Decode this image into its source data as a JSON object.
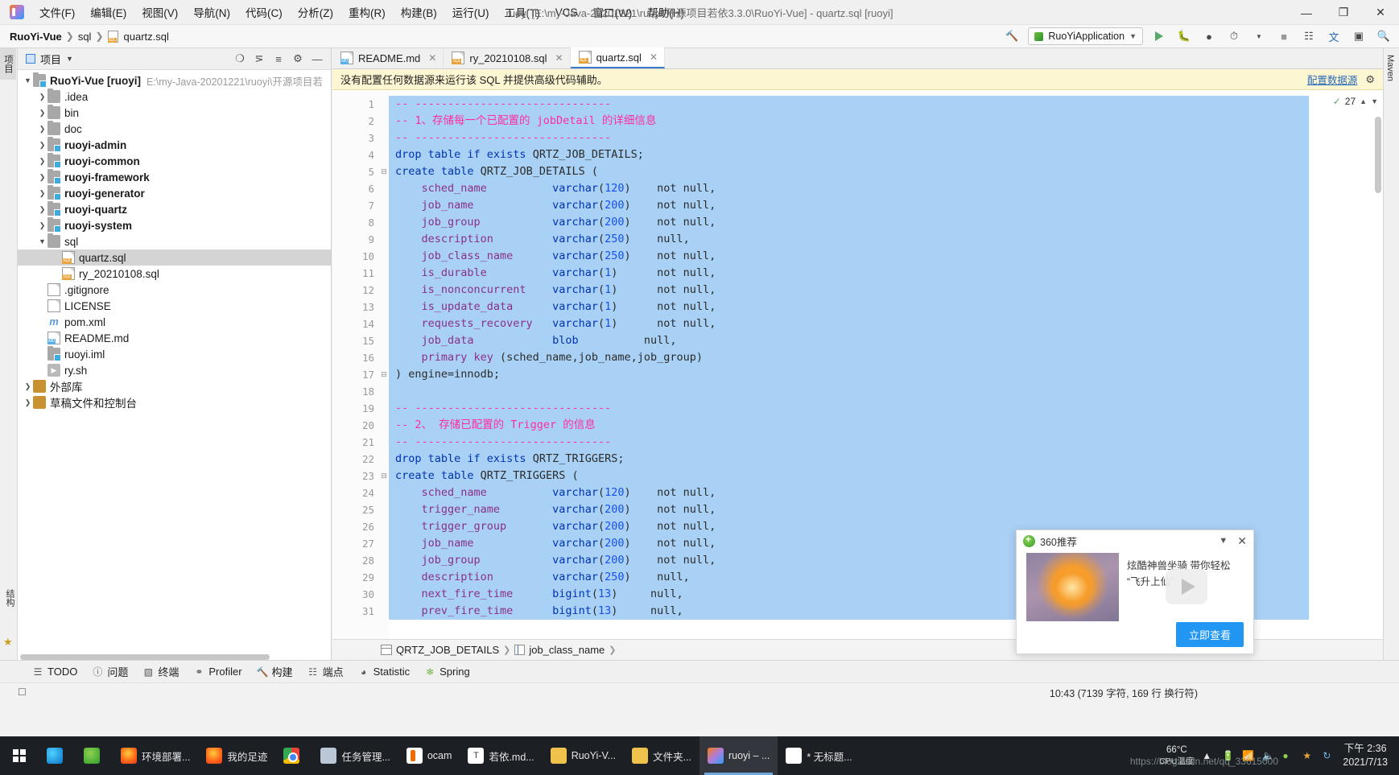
{
  "window": {
    "title": "ruoyi [E:\\my-Java-20201221\\ruoyi\\开源项目若依3.3.0\\RuoYi-Vue] - quartz.sql [ruoyi]",
    "minimize": "—",
    "maximize": "❐",
    "close": "✕"
  },
  "menu": [
    {
      "label": "文件(F)"
    },
    {
      "label": "编辑(E)"
    },
    {
      "label": "视图(V)"
    },
    {
      "label": "导航(N)"
    },
    {
      "label": "代码(C)"
    },
    {
      "label": "分析(Z)"
    },
    {
      "label": "重构(R)"
    },
    {
      "label": "构建(B)"
    },
    {
      "label": "运行(U)"
    },
    {
      "label": "工具(T)"
    },
    {
      "label": "VCS"
    },
    {
      "label": "窗口(W)"
    },
    {
      "label": "帮助(H)"
    }
  ],
  "navbar": {
    "crumbs": [
      "RuoYi-Vue",
      "sql",
      "quartz.sql"
    ],
    "run_config": "RuoYiApplication",
    "icons": [
      "hammer-icon",
      "run-icon",
      "debug-icon",
      "profile-icon",
      "coverage-icon",
      "stop-icon",
      "layout-icon",
      "translate-icon",
      "updates-icon",
      "search-icon"
    ]
  },
  "left_strip": {
    "labels": [
      "项目"
    ]
  },
  "right_strip": {
    "labels": [
      "Maven"
    ]
  },
  "project_panel": {
    "title": "项目",
    "tools": [
      "locate-icon",
      "collapse-all-icon",
      "expand-icon",
      "settings-icon",
      "hide-icon"
    ],
    "tree": [
      {
        "depth": 0,
        "arrow": "open",
        "icon": "module-icon",
        "label": "RuoYi-Vue",
        "suffix": "[ruoyi]",
        "path": "E:\\my-Java-20201221\\ruoyi\\开源项目若",
        "bold": true,
        "selected": false
      },
      {
        "depth": 1,
        "arrow": "closed",
        "icon": "folder-icon",
        "label": ".idea",
        "bold": false,
        "selected": false
      },
      {
        "depth": 1,
        "arrow": "closed",
        "icon": "folder-icon",
        "label": "bin",
        "bold": false,
        "selected": false
      },
      {
        "depth": 1,
        "arrow": "closed",
        "icon": "folder-icon",
        "label": "doc",
        "bold": false,
        "selected": false
      },
      {
        "depth": 1,
        "arrow": "closed",
        "icon": "module-icon",
        "label": "ruoyi-admin",
        "bold": true,
        "selected": false
      },
      {
        "depth": 1,
        "arrow": "closed",
        "icon": "module-icon",
        "label": "ruoyi-common",
        "bold": true,
        "selected": false
      },
      {
        "depth": 1,
        "arrow": "closed",
        "icon": "module-icon",
        "label": "ruoyi-framework",
        "bold": true,
        "selected": false
      },
      {
        "depth": 1,
        "arrow": "closed",
        "icon": "module-icon",
        "label": "ruoyi-generator",
        "bold": true,
        "selected": false
      },
      {
        "depth": 1,
        "arrow": "closed",
        "icon": "module-icon",
        "label": "ruoyi-quartz",
        "bold": true,
        "selected": false
      },
      {
        "depth": 1,
        "arrow": "closed",
        "icon": "module-icon",
        "label": "ruoyi-system",
        "bold": true,
        "selected": false
      },
      {
        "depth": 1,
        "arrow": "open",
        "icon": "folder-icon",
        "label": "sql",
        "bold": false,
        "selected": false
      },
      {
        "depth": 2,
        "arrow": "none",
        "icon": "sql-file-icon",
        "label": "quartz.sql",
        "bold": false,
        "selected": true
      },
      {
        "depth": 2,
        "arrow": "none",
        "icon": "sql-file-icon",
        "label": "ry_20210108.sql",
        "bold": false,
        "selected": false
      },
      {
        "depth": 1,
        "arrow": "none",
        "icon": "gitignore-icon",
        "label": ".gitignore",
        "bold": false,
        "selected": false
      },
      {
        "depth": 1,
        "arrow": "none",
        "icon": "text-file-icon",
        "label": "LICENSE",
        "bold": false,
        "selected": false
      },
      {
        "depth": 1,
        "arrow": "none",
        "icon": "maven-icon",
        "label": "pom.xml",
        "bold": false,
        "selected": false
      },
      {
        "depth": 1,
        "arrow": "none",
        "icon": "md-file-icon",
        "label": "README.md",
        "bold": false,
        "selected": false
      },
      {
        "depth": 1,
        "arrow": "none",
        "icon": "iml-file-icon",
        "label": "ruoyi.iml",
        "bold": false,
        "selected": false
      },
      {
        "depth": 1,
        "arrow": "none",
        "icon": "shell-file-icon",
        "label": "ry.sh",
        "bold": false,
        "selected": false
      },
      {
        "depth": 0,
        "arrow": "closed",
        "icon": "library-icon",
        "label": "外部库",
        "bold": false,
        "selected": false
      },
      {
        "depth": 0,
        "arrow": "closed",
        "icon": "scratch-icon",
        "label": "草稿文件和控制台",
        "bold": false,
        "selected": false
      }
    ]
  },
  "editor": {
    "tabs": [
      {
        "label": "README.md",
        "icon": "md-file-icon",
        "active": false
      },
      {
        "label": "ry_20210108.sql",
        "icon": "sql-file-icon",
        "active": false
      },
      {
        "label": "quartz.sql",
        "icon": "sql-file-icon",
        "active": true
      }
    ],
    "notice": {
      "text": "没有配置任何数据源来运行该 SQL 并提供高级代码辅助。",
      "link": "配置数据源",
      "settings_icon": "gear-icon"
    },
    "inspection": {
      "count": "27",
      "check_icon": "check-icon",
      "up": "⌃",
      "down": "⌄"
    },
    "first_line": 1,
    "lines": [
      {
        "n": 1,
        "fold": "",
        "tokens": [
          [
            "cmt",
            "-- ------------------------------"
          ]
        ]
      },
      {
        "n": 2,
        "fold": "",
        "tokens": [
          [
            "cmt",
            "-- 1、存储每一个已配置的 jobDetail 的详细信息"
          ]
        ]
      },
      {
        "n": 3,
        "fold": "",
        "tokens": [
          [
            "cmt",
            "-- ------------------------------"
          ]
        ]
      },
      {
        "n": 4,
        "fold": "",
        "tokens": [
          [
            "kw",
            "drop table if exists "
          ],
          [
            "nn",
            "QRTZ_JOB_DETAILS;"
          ]
        ]
      },
      {
        "n": 5,
        "fold": "-",
        "tokens": [
          [
            "kw",
            "create table "
          ],
          [
            "nn",
            "QRTZ_JOB_DETAILS ("
          ]
        ]
      },
      {
        "n": 6,
        "fold": "",
        "tokens": [
          [
            "col",
            "    sched_name          "
          ],
          [
            "typ",
            "varchar"
          ],
          [
            "nn",
            "("
          ],
          [
            "num",
            "120"
          ],
          [
            "nn",
            ")    "
          ],
          [
            "nn",
            "not null,"
          ]
        ]
      },
      {
        "n": 7,
        "fold": "",
        "tokens": [
          [
            "col",
            "    job_name            "
          ],
          [
            "typ",
            "varchar"
          ],
          [
            "nn",
            "("
          ],
          [
            "num",
            "200"
          ],
          [
            "nn",
            ")    "
          ],
          [
            "nn",
            "not null,"
          ]
        ]
      },
      {
        "n": 8,
        "fold": "",
        "tokens": [
          [
            "col",
            "    job_group           "
          ],
          [
            "typ",
            "varchar"
          ],
          [
            "nn",
            "("
          ],
          [
            "num",
            "200"
          ],
          [
            "nn",
            ")    "
          ],
          [
            "nn",
            "not null,"
          ]
        ]
      },
      {
        "n": 9,
        "fold": "",
        "tokens": [
          [
            "col",
            "    description         "
          ],
          [
            "typ",
            "varchar"
          ],
          [
            "nn",
            "("
          ],
          [
            "num",
            "250"
          ],
          [
            "nn",
            ")    "
          ],
          [
            "nn",
            "null,"
          ]
        ]
      },
      {
        "n": 10,
        "fold": "",
        "tokens": [
          [
            "col",
            "    job_class_name      "
          ],
          [
            "typ",
            "varchar"
          ],
          [
            "nn",
            "("
          ],
          [
            "num",
            "250"
          ],
          [
            "nn",
            ")    "
          ],
          [
            "nn",
            "not null,"
          ]
        ]
      },
      {
        "n": 11,
        "fold": "",
        "tokens": [
          [
            "col",
            "    is_durable          "
          ],
          [
            "typ",
            "varchar"
          ],
          [
            "nn",
            "("
          ],
          [
            "num",
            "1"
          ],
          [
            "nn",
            ")      "
          ],
          [
            "nn",
            "not null,"
          ]
        ]
      },
      {
        "n": 12,
        "fold": "",
        "tokens": [
          [
            "col",
            "    is_nonconcurrent    "
          ],
          [
            "typ",
            "varchar"
          ],
          [
            "nn",
            "("
          ],
          [
            "num",
            "1"
          ],
          [
            "nn",
            ")      "
          ],
          [
            "nn",
            "not null,"
          ]
        ]
      },
      {
        "n": 13,
        "fold": "",
        "tokens": [
          [
            "col",
            "    is_update_data      "
          ],
          [
            "typ",
            "varchar"
          ],
          [
            "nn",
            "("
          ],
          [
            "num",
            "1"
          ],
          [
            "nn",
            ")      "
          ],
          [
            "nn",
            "not null,"
          ]
        ]
      },
      {
        "n": 14,
        "fold": "",
        "tokens": [
          [
            "col",
            "    requests_recovery   "
          ],
          [
            "typ",
            "varchar"
          ],
          [
            "nn",
            "("
          ],
          [
            "num",
            "1"
          ],
          [
            "nn",
            ")      "
          ],
          [
            "nn",
            "not null,"
          ]
        ]
      },
      {
        "n": 15,
        "fold": "",
        "tokens": [
          [
            "col",
            "    job_data            "
          ],
          [
            "typ",
            "blob"
          ],
          [
            "nn",
            "          "
          ],
          [
            "nn",
            "null,"
          ]
        ]
      },
      {
        "n": 16,
        "fold": "",
        "tokens": [
          [
            "col",
            "    primary key "
          ],
          [
            "nn",
            "(sched_name,job_name,job_group)"
          ]
        ]
      },
      {
        "n": 17,
        "fold": "-",
        "tokens": [
          [
            "nn",
            ") engine=innodb;"
          ]
        ]
      },
      {
        "n": 18,
        "fold": "",
        "tokens": [
          [
            "nn",
            ""
          ]
        ]
      },
      {
        "n": 19,
        "fold": "",
        "tokens": [
          [
            "cmt",
            "-- ------------------------------"
          ]
        ]
      },
      {
        "n": 20,
        "fold": "",
        "tokens": [
          [
            "cmt",
            "-- 2、 存储已配置的 Trigger 的信息"
          ]
        ]
      },
      {
        "n": 21,
        "fold": "",
        "tokens": [
          [
            "cmt",
            "-- ------------------------------"
          ]
        ]
      },
      {
        "n": 22,
        "fold": "",
        "tokens": [
          [
            "kw",
            "drop table if exists "
          ],
          [
            "nn",
            "QRTZ_TRIGGERS;"
          ]
        ]
      },
      {
        "n": 23,
        "fold": "-",
        "tokens": [
          [
            "kw",
            "create table "
          ],
          [
            "nn",
            "QRTZ_TRIGGERS ("
          ]
        ]
      },
      {
        "n": 24,
        "fold": "",
        "tokens": [
          [
            "col",
            "    sched_name          "
          ],
          [
            "typ",
            "varchar"
          ],
          [
            "nn",
            "("
          ],
          [
            "num",
            "120"
          ],
          [
            "nn",
            ")    "
          ],
          [
            "nn",
            "not null,"
          ]
        ]
      },
      {
        "n": 25,
        "fold": "",
        "tokens": [
          [
            "col",
            "    trigger_name        "
          ],
          [
            "typ",
            "varchar"
          ],
          [
            "nn",
            "("
          ],
          [
            "num",
            "200"
          ],
          [
            "nn",
            ")    "
          ],
          [
            "nn",
            "not null,"
          ]
        ]
      },
      {
        "n": 26,
        "fold": "",
        "tokens": [
          [
            "col",
            "    trigger_group       "
          ],
          [
            "typ",
            "varchar"
          ],
          [
            "nn",
            "("
          ],
          [
            "num",
            "200"
          ],
          [
            "nn",
            ")    "
          ],
          [
            "nn",
            "not null,"
          ]
        ]
      },
      {
        "n": 27,
        "fold": "",
        "tokens": [
          [
            "col",
            "    job_name            "
          ],
          [
            "typ",
            "varchar"
          ],
          [
            "nn",
            "("
          ],
          [
            "num",
            "200"
          ],
          [
            "nn",
            ")    "
          ],
          [
            "nn",
            "not null,"
          ]
        ]
      },
      {
        "n": 28,
        "fold": "",
        "tokens": [
          [
            "col",
            "    job_group           "
          ],
          [
            "typ",
            "varchar"
          ],
          [
            "nn",
            "("
          ],
          [
            "num",
            "200"
          ],
          [
            "nn",
            ")    "
          ],
          [
            "nn",
            "not null,"
          ]
        ]
      },
      {
        "n": 29,
        "fold": "",
        "tokens": [
          [
            "col",
            "    description         "
          ],
          [
            "typ",
            "varchar"
          ],
          [
            "nn",
            "("
          ],
          [
            "num",
            "250"
          ],
          [
            "nn",
            ")    "
          ],
          [
            "nn",
            "null,"
          ]
        ]
      },
      {
        "n": 30,
        "fold": "",
        "tokens": [
          [
            "col",
            "    next_fire_time      "
          ],
          [
            "typ",
            "bigint"
          ],
          [
            "nn",
            "("
          ],
          [
            "num",
            "13"
          ],
          [
            "nn",
            ")     "
          ],
          [
            "nn",
            "null,"
          ]
        ]
      },
      {
        "n": 31,
        "fold": "",
        "tokens": [
          [
            "col",
            "    prev_fire_time      "
          ],
          [
            "typ",
            "bigint"
          ],
          [
            "nn",
            "("
          ],
          [
            "num",
            "13"
          ],
          [
            "nn",
            ")     "
          ],
          [
            "nn",
            "null,"
          ]
        ]
      }
    ],
    "breadcrumb": [
      {
        "label": "QRTZ_JOB_DETAILS",
        "icon": "table-icon"
      },
      {
        "label": "job_class_name",
        "icon": "column-icon"
      }
    ]
  },
  "bottom_toolwindows": [
    {
      "label": "TODO",
      "icon": "todo-icon"
    },
    {
      "label": "问题",
      "icon": "problems-icon"
    },
    {
      "label": "终端",
      "icon": "terminal-icon"
    },
    {
      "label": "Profiler",
      "icon": "profiler-icon"
    },
    {
      "label": "构建",
      "icon": "build-icon"
    },
    {
      "label": "端点",
      "icon": "endpoints-icon"
    },
    {
      "label": "Statistic",
      "icon": "statistic-icon"
    },
    {
      "label": "Spring",
      "icon": "spring-icon"
    }
  ],
  "status_bar": {
    "text": "10:43 (7139 字符, 169 行 换行符)"
  },
  "popup_360": {
    "title": "360推荐",
    "logo_icon": "360-logo-icon",
    "collapse_icon": "chevron-down-icon",
    "close_icon": "close-icon",
    "play_icon": "play-icon",
    "text_line1": "炫酷神兽坐骑 带你轻松",
    "text_line2": "“飞升上仙”",
    "cta": "立即查看"
  },
  "taskbar": {
    "start_icon": "windows-start-icon",
    "items": [
      {
        "label": "",
        "icon": "edge-icon",
        "active": false
      },
      {
        "label": "",
        "icon": "360-browser-icon",
        "active": false
      },
      {
        "label": "环境部署...",
        "icon": "firefox-icon",
        "active": false
      },
      {
        "label": "我的足迹",
        "icon": "firefox-icon",
        "active": false
      },
      {
        "label": "",
        "icon": "chrome-icon",
        "active": false
      },
      {
        "label": "任务管理...",
        "icon": "task-manager-icon",
        "active": false
      },
      {
        "label": "ocam",
        "icon": "ocam-icon",
        "active": false
      },
      {
        "label": "若依.md...",
        "icon": "typora-icon",
        "active": false
      },
      {
        "label": "RuoYi-V...",
        "icon": "folder-icon",
        "active": false
      },
      {
        "label": "文件夹...",
        "icon": "explorer-icon",
        "active": false
      },
      {
        "label": "ruoyi – ...",
        "icon": "idea-icon",
        "active": true
      },
      {
        "label": "* 无标题...",
        "icon": "notepad-icon",
        "active": false
      }
    ],
    "temp_value": "66°C",
    "temp_label": "CPU温度",
    "clock_time": "下午 2:36",
    "clock_date": "2021/7/13",
    "tray_icons": [
      "chevron-up-icon",
      "battery-icon",
      "network-icon",
      "volume-icon",
      "360-icon",
      "shield-icon",
      "sync-icon"
    ]
  },
  "watermark": "https://blog.csdn.net/qq_33615000"
}
